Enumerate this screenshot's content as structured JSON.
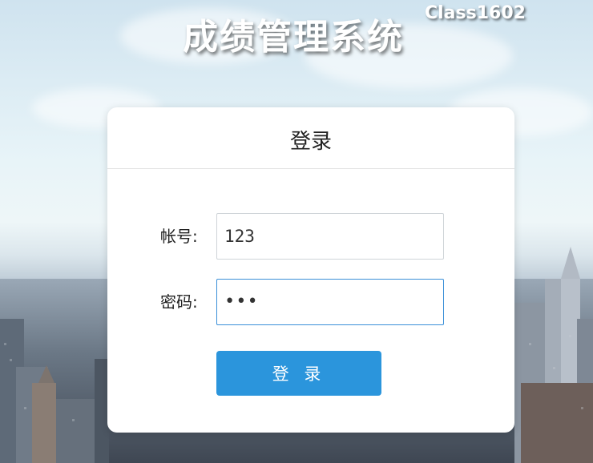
{
  "header": {
    "app_title": "成绩管理系统",
    "class_badge": "Class1602"
  },
  "login_card": {
    "title": "登录",
    "account_label": "帐号:",
    "account_value": "123",
    "password_label": "密码:",
    "password_masked": "•••",
    "submit_label": "登 录"
  },
  "colors": {
    "button": "#2b95dc",
    "focus_border": "#3a8fd8",
    "card": "#ffffff"
  },
  "icons": [
    "background-city-image"
  ]
}
